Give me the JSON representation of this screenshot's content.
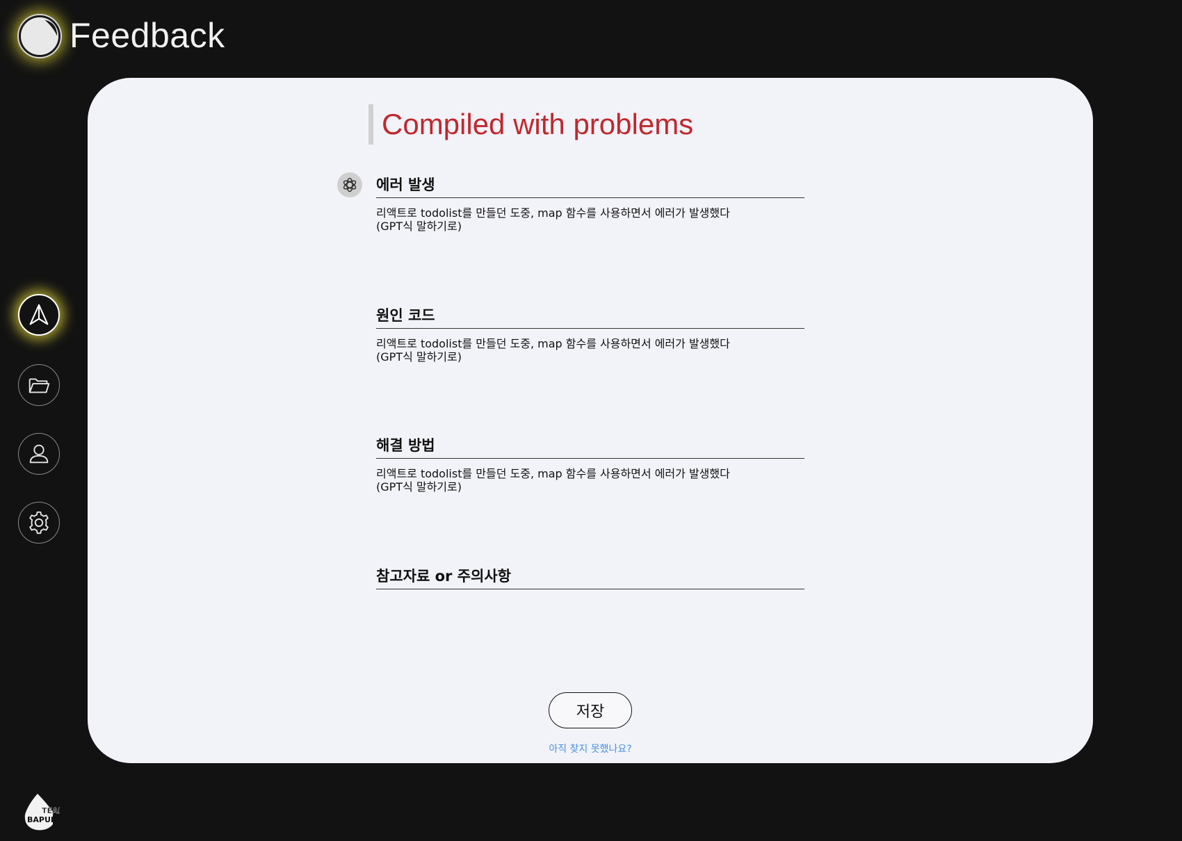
{
  "header": {
    "title": "Feedback",
    "logo_icon": "moon-logo-icon"
  },
  "sidebar": {
    "items": [
      {
        "name": "send",
        "icon": "paper-plane-icon",
        "active": true
      },
      {
        "name": "folder",
        "icon": "folder-icon",
        "active": false
      },
      {
        "name": "profile",
        "icon": "user-icon",
        "active": false
      },
      {
        "name": "settings",
        "icon": "gear-icon",
        "active": false
      }
    ],
    "team_logo_text": "TEAM BAPULL",
    "glow_color": "#ebe13c"
  },
  "card": {
    "title": "Compiled with problems",
    "title_color": "#c1272d",
    "avatar_icon": "chatgpt-icon",
    "sections": [
      {
        "heading": "에러 발생",
        "body": "리액트로 todolist를 만들던 도중, map 함수를 사용하면서 에러가 발생했다\n(GPT식 말하기로)"
      },
      {
        "heading": "원인 코드",
        "body": "리액트로 todolist를 만들던 도중, map 함수를 사용하면서 에러가 발생했다\n(GPT식 말하기로)"
      },
      {
        "heading": "해결 방법",
        "body": "리액트로 todolist를 만들던 도중, map 함수를 사용하면서 에러가 발생했다\n(GPT식 말하기로)"
      },
      {
        "heading": "참고자료 or 주의사항",
        "body": ""
      }
    ],
    "save_label": "저장",
    "help_link": "아직 찾지 못했나요?",
    "link_color": "#4a90e2"
  }
}
